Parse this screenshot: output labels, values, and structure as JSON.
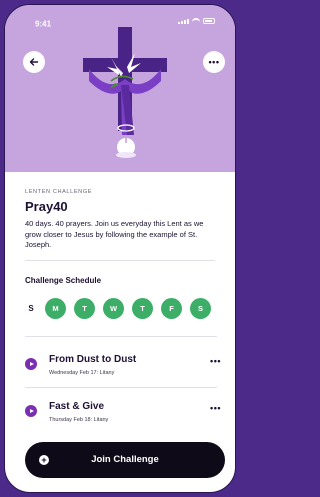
{
  "status_bar": {
    "time": "9:41"
  },
  "hero": {
    "background": "#c6a4dd",
    "back_icon": "arrow-left-icon",
    "more_icon": "more-horizontal-icon",
    "more_glyph": "•••"
  },
  "challenge": {
    "eyebrow": "LENTEN CHALLENGE",
    "title": "Pray40",
    "description": "40 days. 40 prayers. Join us everyday this Lent as we grow closer to Jesus by following the example of St. Joseph."
  },
  "schedule": {
    "title": "Challenge Schedule",
    "days": [
      {
        "label": "S",
        "active": false
      },
      {
        "label": "M",
        "active": true
      },
      {
        "label": "T",
        "active": true
      },
      {
        "label": "W",
        "active": true
      },
      {
        "label": "T",
        "active": true
      },
      {
        "label": "F",
        "active": true
      },
      {
        "label": "S",
        "active": true
      }
    ],
    "active_color": "#3dae67"
  },
  "sessions": [
    {
      "title": "From Dust to Dust",
      "subtitle": "Wednesday Feb 17: Litany",
      "more": "•••"
    },
    {
      "title": "Fast & Give",
      "subtitle": "Thursday Feb 18: Litany",
      "more": "•••"
    }
  ],
  "cta": {
    "label": "Join Challenge",
    "icon": "plus-icon",
    "glyph": "+"
  },
  "colors": {
    "accent_purple": "#7a2fb3",
    "cta_bg": "#0f0a17"
  }
}
